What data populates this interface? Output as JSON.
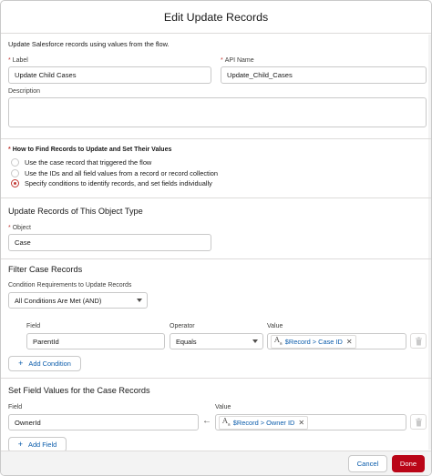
{
  "header": {
    "title": "Edit Update Records"
  },
  "description_text": "Update Salesforce records using values from the flow.",
  "label_field": {
    "label": "Label",
    "value": "Update Child Cases"
  },
  "api_name_field": {
    "label": "API Name",
    "value": "Update_Child_Cases"
  },
  "description_field": {
    "label": "Description",
    "value": ""
  },
  "how_to_find": {
    "label": "How to Find Records to Update and Set Their Values",
    "options": [
      {
        "label": "Use the case record that triggered the flow",
        "selected": false
      },
      {
        "label": "Use the IDs and all field values from a record or record collection",
        "selected": false
      },
      {
        "label": "Specify conditions to identify records, and set fields individually",
        "selected": true
      }
    ]
  },
  "object_section": {
    "title": "Update Records of This Object Type",
    "object_label": "Object",
    "object_value": "Case"
  },
  "filter_section": {
    "title": "Filter Case Records",
    "condition_req_label": "Condition Requirements to Update Records",
    "condition_req_value": "All Conditions Are Met (AND)",
    "columns": {
      "field": "Field",
      "operator": "Operator",
      "value": "Value"
    },
    "row": {
      "field": "ParentId",
      "operator": "Equals",
      "value_icon": "text-type-icon",
      "value": "$Record > Case ID"
    },
    "add_condition_label": "Add Condition"
  },
  "set_fields_section": {
    "title": "Set Field Values for the Case Records",
    "columns": {
      "field": "Field",
      "value": "Value"
    },
    "row": {
      "field": "OwnerId",
      "value_icon": "text-type-icon",
      "value": "$Record > Owner ID"
    },
    "add_field_label": "Add Field"
  },
  "footer": {
    "cancel_label": "Cancel",
    "done_label": "Done"
  },
  "colors": {
    "brand": "#0b5cab",
    "required": "#c23934",
    "done_bg": "#ba0517"
  }
}
